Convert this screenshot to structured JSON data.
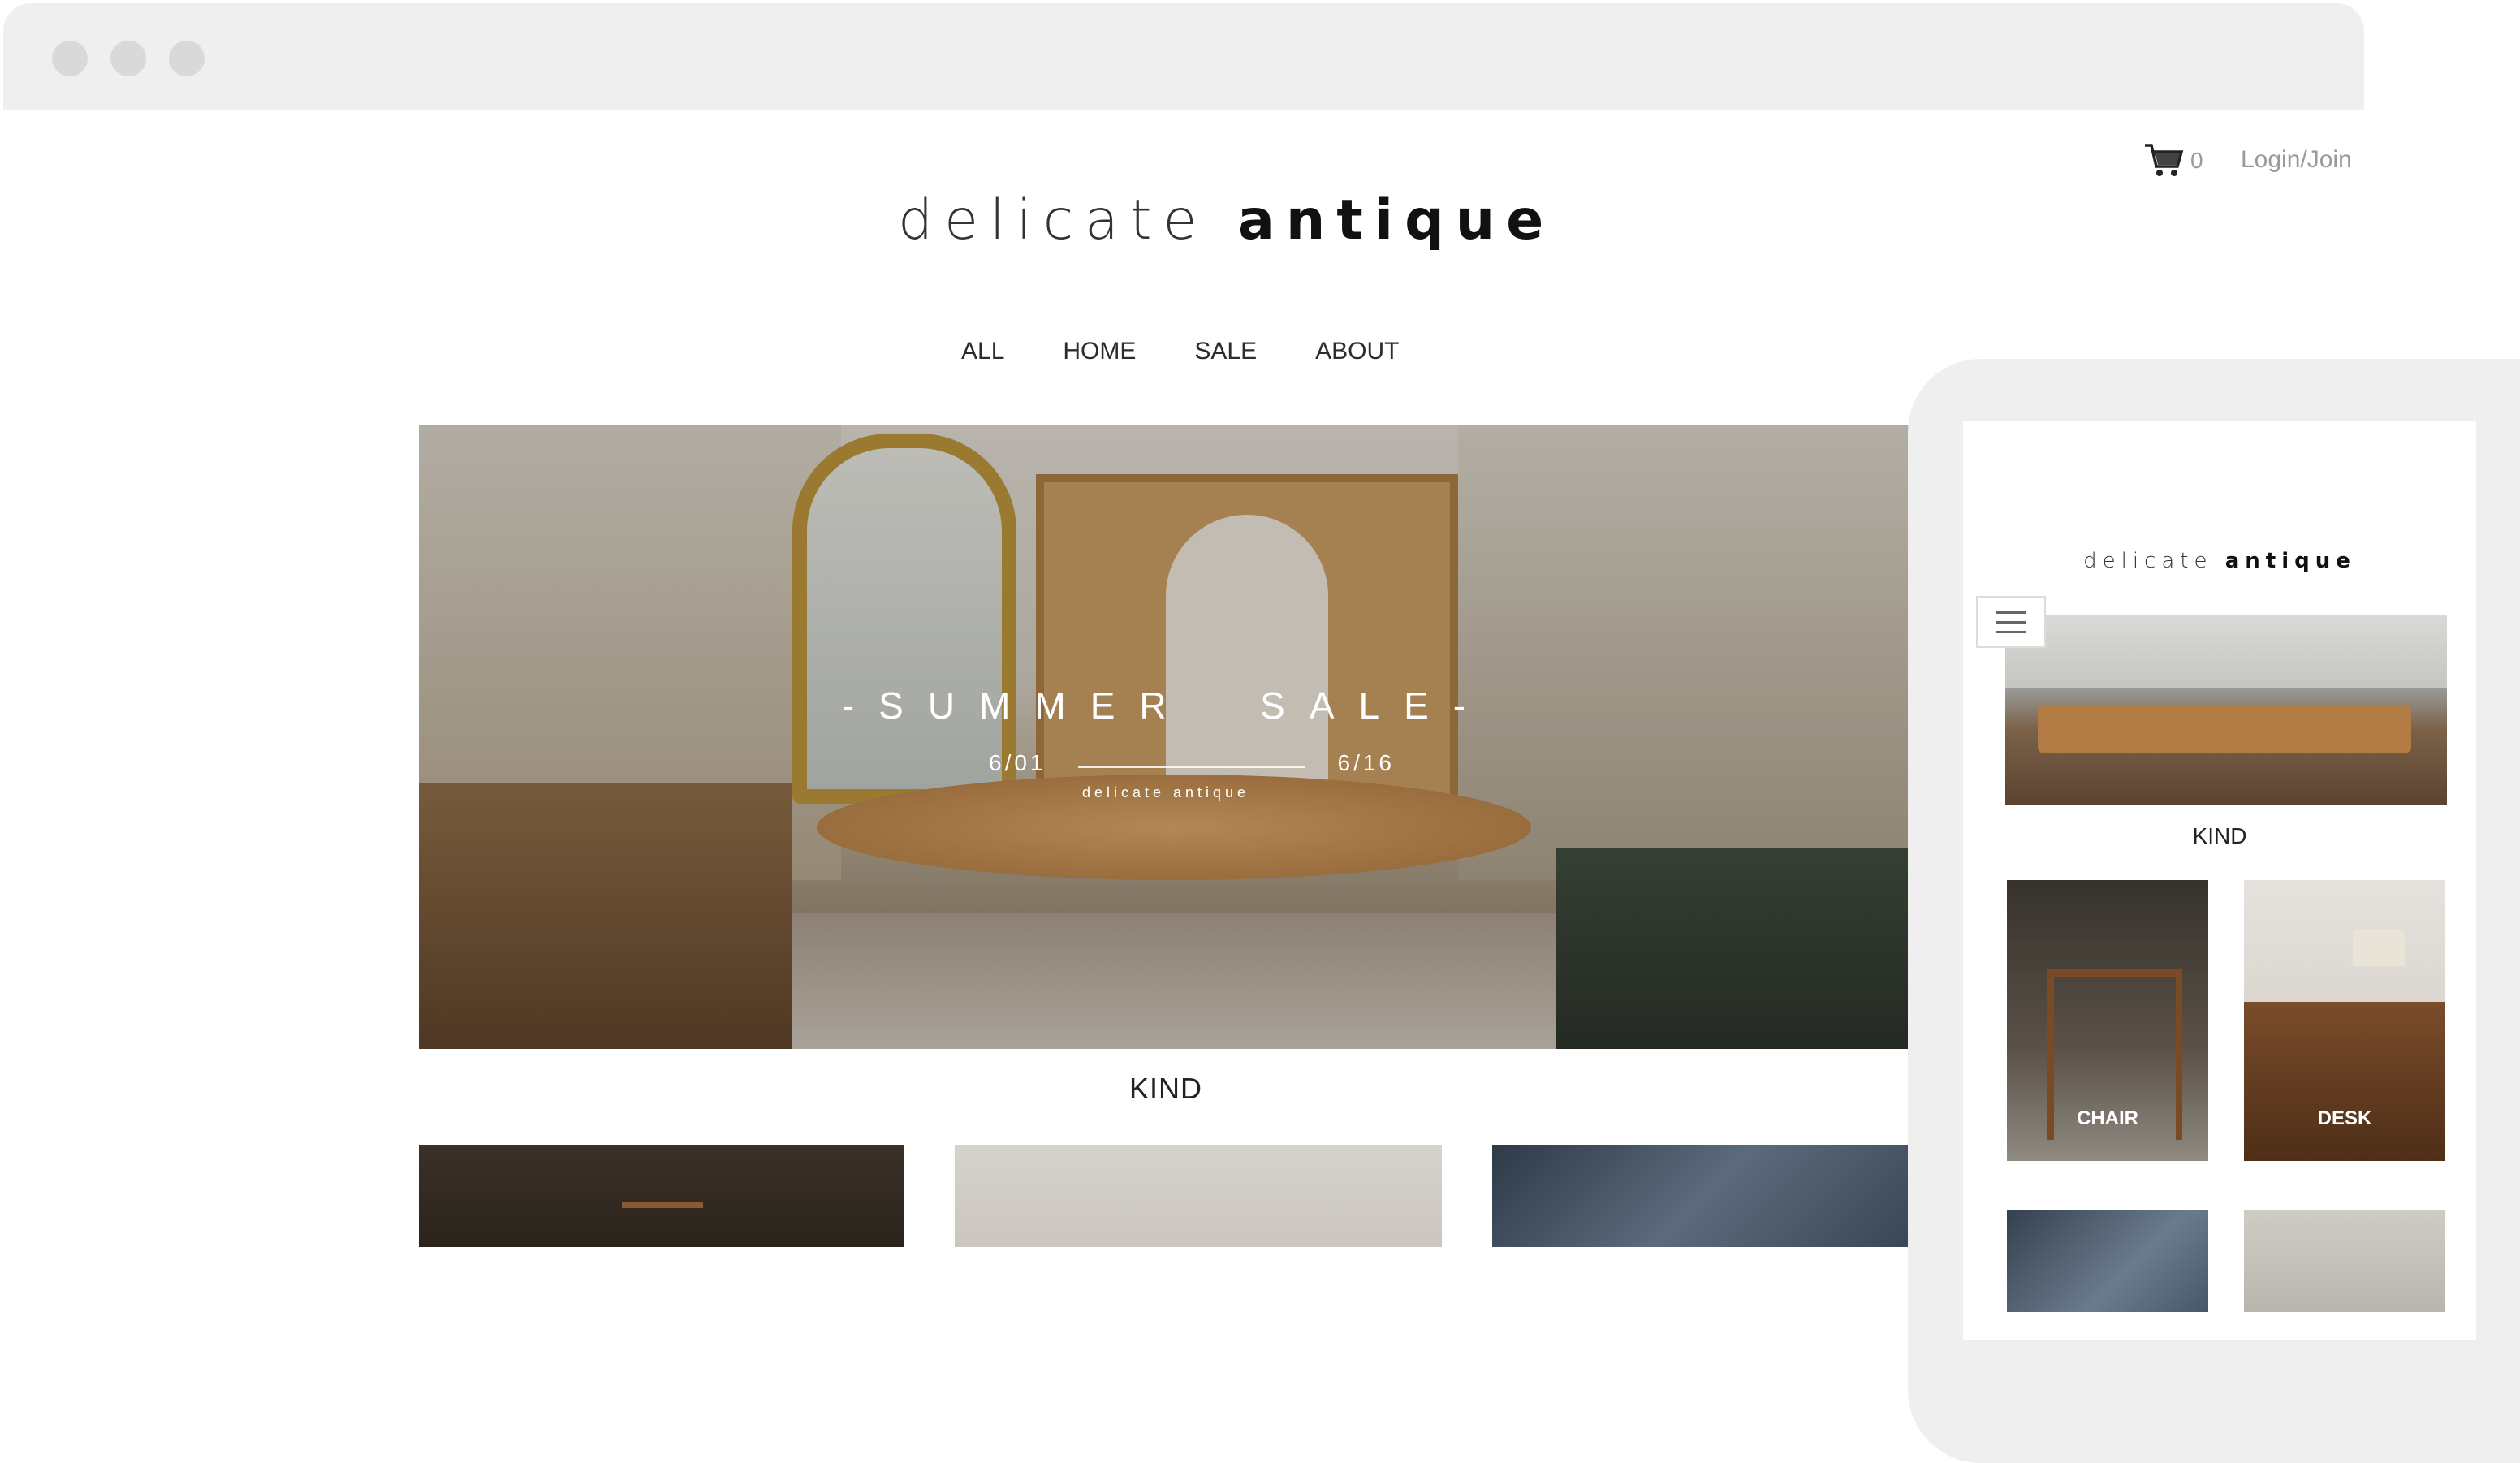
{
  "desktop": {
    "cart": {
      "count": "0"
    },
    "login_label": "Login/Join",
    "logo": {
      "light": "delicate ",
      "bold": "antique"
    },
    "nav": [
      {
        "label": "ALL"
      },
      {
        "label": "HOME"
      },
      {
        "label": "SALE"
      },
      {
        "label": "ABOUT"
      }
    ],
    "hero": {
      "title": "-SUMMER  SALE-",
      "date_from": "6/01",
      "date_to": "6/16",
      "brand": "delicate antique"
    },
    "kind_title": "KIND"
  },
  "mobile": {
    "logo": {
      "light": "delicate ",
      "bold": "antique"
    },
    "kind_title": "KIND",
    "cards": [
      {
        "label": "CHAIR"
      },
      {
        "label": "DESK"
      },
      {
        "label": ""
      },
      {
        "label": ""
      }
    ]
  },
  "colors": {
    "frame": "#efefef",
    "text": "#222222",
    "muted": "#9a9a9a"
  }
}
